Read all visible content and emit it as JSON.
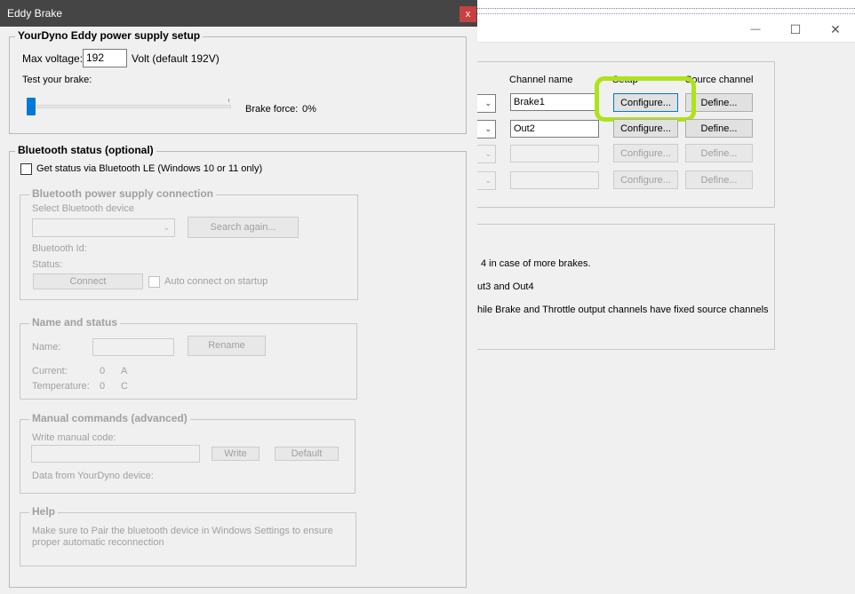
{
  "background_window": {
    "controls": {
      "minimize": "—",
      "maximize": "☐",
      "close": "✕"
    },
    "channels": {
      "headers": {
        "name": "Channel name",
        "setup": "Setup",
        "source": "Source channel"
      },
      "rows": [
        {
          "name": "Brake1",
          "configure": "Configure...",
          "define": "Define...",
          "enabled": true
        },
        {
          "name": "Out2",
          "configure": "Configure...",
          "define": "Define...",
          "enabled": true
        },
        {
          "name": "",
          "configure": "Configure...",
          "define": "Define...",
          "enabled": false
        },
        {
          "name": "",
          "configure": "Configure...",
          "define": "Define...",
          "enabled": false
        }
      ]
    },
    "info_lines": [
      "4 in case of more brakes.",
      "ut3 and Out4",
      "hile Brake and Throttle output channels have fixed source channels"
    ],
    "highlight_color": "#aee31a"
  },
  "dialog": {
    "title": "Eddy Brake",
    "close_label": "x",
    "power_setup": {
      "title": "YourDyno Eddy power supply setup",
      "max_voltage_label": "Max voltage:",
      "max_voltage_value": "192",
      "volt_note": "Volt (default 192V)",
      "test_label": "Test your brake:",
      "brake_force_label": "Brake force:",
      "brake_force_value": "0%",
      "slider_fraction": 0
    },
    "bluetooth_status": {
      "title": "Bluetooth status (optional)",
      "checkbox_label": "Get status via Bluetooth LE (Windows 10 or 11 only)",
      "checked": false,
      "connection": {
        "title": "Bluetooth power supply connection",
        "select_label": "Select Bluetooth device",
        "search_again": "Search again...",
        "id_label": "Bluetooth Id:",
        "status_label": "Status:",
        "connect": "Connect",
        "auto_connect": "Auto connect on startup"
      },
      "name_status": {
        "title": "Name and status",
        "name_label": "Name:",
        "rename": "Rename",
        "current_label": "Current:",
        "current_value": "0",
        "current_unit": "A",
        "temperature_label": "Temperature:",
        "temperature_value": "0",
        "temperature_unit": "C"
      },
      "manual": {
        "title": "Manual commands (advanced)",
        "write_label": "Write manual code:",
        "write": "Write",
        "default": "Default",
        "data_label": "Data from YourDyno device:"
      },
      "help": {
        "title": "Help",
        "text": "Make sure to Pair the bluetooth device in Windows Settings to ensure proper automatic reconnection"
      }
    }
  }
}
